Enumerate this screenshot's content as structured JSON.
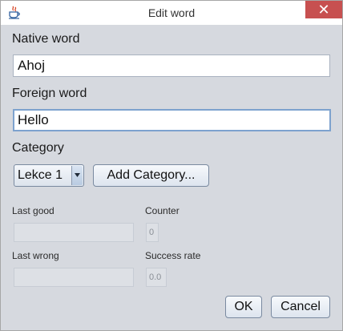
{
  "window": {
    "title": "Edit word",
    "close_glyph": "✕",
    "icon": "java-cup-icon"
  },
  "form": {
    "native_label": "Native word",
    "native_value": "Ahoj",
    "foreign_label": "Foreign word",
    "foreign_value": "Hello",
    "category_label": "Category",
    "category_selected": "Lekce 1",
    "add_category_label": "Add Category...",
    "last_good_label": "Last good",
    "last_good_value": "",
    "counter_label": "Counter",
    "counter_value": "0",
    "last_wrong_label": "Last wrong",
    "last_wrong_value": "",
    "success_rate_label": "Success rate",
    "success_rate_value": "0.0"
  },
  "buttons": {
    "ok_label": "OK",
    "cancel_label": "Cancel"
  },
  "colors": {
    "close_button": "#c75050",
    "dialog_background": "#d6d9df",
    "focus_border": "#7da2ce"
  }
}
